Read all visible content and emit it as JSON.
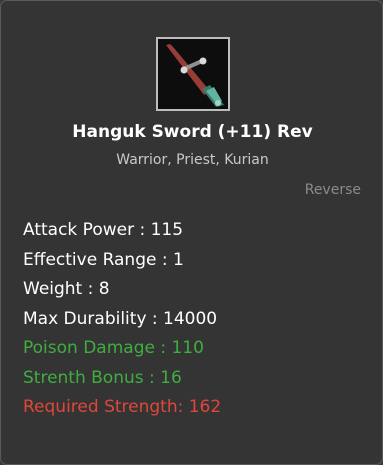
{
  "item": {
    "icon": "sword-icon",
    "name": "Hanguk Sword (+11) Rev",
    "classes": "Warrior, Priest, Kurian",
    "type": "Reverse"
  },
  "stats": [
    {
      "text": "Attack Power : 115",
      "kind": "normal"
    },
    {
      "text": "Effective Range : 1",
      "kind": "normal"
    },
    {
      "text": "Weight : 8",
      "kind": "normal"
    },
    {
      "text": "Max Durability : 14000",
      "kind": "normal"
    },
    {
      "text": "Poison Damage : 110",
      "kind": "bonus"
    },
    {
      "text": "Strenth Bonus : 16",
      "kind": "bonus"
    },
    {
      "text": "Required Strength: 162",
      "kind": "requirement"
    }
  ],
  "colors": {
    "normal": "#ffffff",
    "bonus": "#3fae3f",
    "requirement": "#e0473a",
    "muted": "#8a8a8a"
  }
}
